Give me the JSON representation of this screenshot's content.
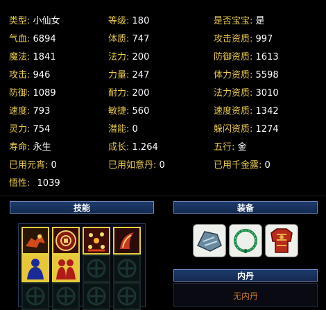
{
  "stats": {
    "col1": [
      {
        "label": "类型:",
        "value": "小仙女"
      },
      {
        "label": "气血:",
        "value": "6894"
      },
      {
        "label": "魔法:",
        "value": "1841"
      },
      {
        "label": "攻击:",
        "value": "946"
      },
      {
        "label": "防御:",
        "value": "1089"
      },
      {
        "label": "速度:",
        "value": "793"
      },
      {
        "label": "灵力:",
        "value": "754"
      },
      {
        "label": "寿命:",
        "value": "永生"
      },
      {
        "label": "已用元宵:",
        "value": "0"
      },
      {
        "label": "悟性:",
        "value": "1039"
      }
    ],
    "col2": [
      {
        "label": "等级:",
        "value": "180"
      },
      {
        "label": "体质:",
        "value": "747"
      },
      {
        "label": "法力:",
        "value": "200"
      },
      {
        "label": "力量:",
        "value": "247"
      },
      {
        "label": "耐力:",
        "value": "200"
      },
      {
        "label": "敏捷:",
        "value": "560"
      },
      {
        "label": "潜能:",
        "value": "0"
      },
      {
        "label": "成长:",
        "value": "1.264"
      },
      {
        "label": "已用如意丹:",
        "value": "0"
      }
    ],
    "col3": [
      {
        "label": "是否宝宝:",
        "value": "是"
      },
      {
        "label": "攻击资质:",
        "value": "997"
      },
      {
        "label": "防御资质:",
        "value": "1613"
      },
      {
        "label": "体力资质:",
        "value": "5598"
      },
      {
        "label": "法力资质:",
        "value": "3010"
      },
      {
        "label": "速度资质:",
        "value": "1342"
      },
      {
        "label": "躲闪资质:",
        "value": "1274"
      },
      {
        "label": "五行:",
        "value": "金"
      },
      {
        "label": "已用千金露:",
        "value": "0"
      }
    ]
  },
  "skills": {
    "title": "技能",
    "slots": [
      {
        "icon": "charging-beast-skill-icon",
        "filled": true
      },
      {
        "icon": "round-seal-skill-icon",
        "filled": true
      },
      {
        "icon": "sparkle-burst-skill-icon",
        "filled": true
      },
      {
        "icon": "horn-skill-icon",
        "filled": true
      },
      {
        "icon": "blue-figure-skill-icon",
        "filled": true
      },
      {
        "icon": "red-figures-skill-icon",
        "filled": true
      },
      {
        "icon": "empty-slot-icon",
        "filled": false
      },
      {
        "icon": "empty-slot-icon",
        "filled": false
      },
      {
        "icon": "empty-slot-icon",
        "filled": false
      },
      {
        "icon": "empty-slot-icon",
        "filled": false
      },
      {
        "icon": "empty-slot-icon",
        "filled": false
      },
      {
        "icon": "empty-slot-icon",
        "filled": false
      }
    ]
  },
  "equipment": {
    "title": "装备",
    "items": [
      {
        "icon": "gauntlet-icon"
      },
      {
        "icon": "jade-necklace-icon"
      },
      {
        "icon": "red-armor-icon"
      }
    ]
  },
  "neidan": {
    "title": "内丹",
    "empty_text": "无内丹"
  },
  "colors": {
    "label": "#e8c94a",
    "value": "#ffffff",
    "header_bg": "#1f3b6b",
    "neidan_empty": "#c87a28"
  }
}
